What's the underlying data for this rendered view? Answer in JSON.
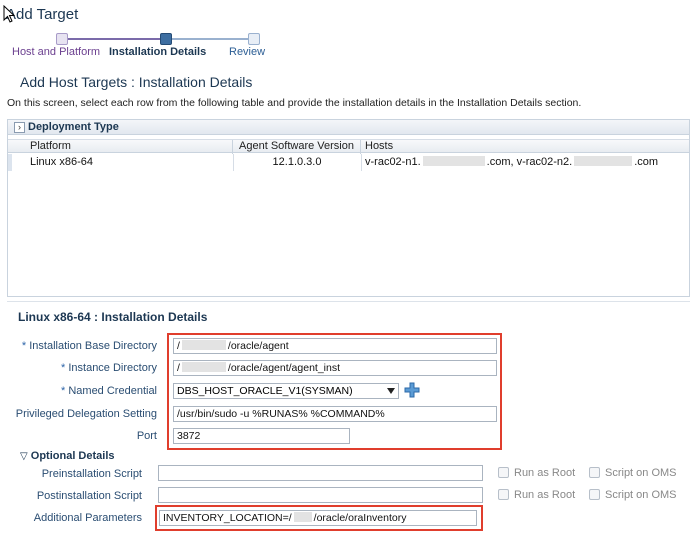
{
  "page": {
    "title": "Add Target"
  },
  "train": {
    "steps": [
      {
        "label": "Host and Platform",
        "state": "done"
      },
      {
        "label": "Installation Details",
        "state": "current"
      },
      {
        "label": "Review",
        "state": "todo"
      }
    ]
  },
  "section": {
    "title": "Add Host Targets : Installation Details",
    "instructions": "On this screen, select each row from the following table and provide the installation details in the Installation Details section."
  },
  "deployment": {
    "title": "Deployment Type",
    "columns": [
      "Platform",
      "Agent Software Version",
      "Hosts"
    ],
    "rows": [
      {
        "platform": "Linux x86-64",
        "version": "12.1.0.3.0",
        "hosts_part1": "v-rac02-n1.",
        "hosts_part2": ".com, v-rac02-n2.",
        "hosts_part3": ".com"
      }
    ]
  },
  "details": {
    "title": "Linux x86-64 : Installation Details",
    "fields": {
      "base_dir": {
        "label": "Installation Base Directory",
        "value_prefix": "/",
        "value_suffix": "/oracle/agent"
      },
      "instance_dir": {
        "label": "Instance Directory",
        "value_prefix": "/",
        "value_suffix": "/oracle/agent/agent_inst"
      },
      "credential": {
        "label": "Named Credential",
        "value": "DBS_HOST_ORACLE_V1(SYSMAN)"
      },
      "privileged": {
        "label": "Privileged Delegation Setting",
        "value": "/usr/bin/sudo -u %RUNAS% %COMMAND%"
      },
      "port": {
        "label": "Port",
        "value": "3872"
      }
    },
    "required_marker": "*"
  },
  "optional": {
    "title": "Optional Details",
    "preinstall": {
      "label": "Preinstallation Script",
      "value": ""
    },
    "postinstall": {
      "label": "Postinstallation Script",
      "value": ""
    },
    "additional": {
      "label": "Additional Parameters",
      "value_prefix": "INVENTORY_LOCATION=/",
      "value_suffix": "/oracle/oraInventory"
    },
    "run_as_root": "Run as Root",
    "script_on_oms": "Script on OMS"
  },
  "colors": {
    "accent": "#1c3752",
    "highlight": "#e03e2d"
  }
}
